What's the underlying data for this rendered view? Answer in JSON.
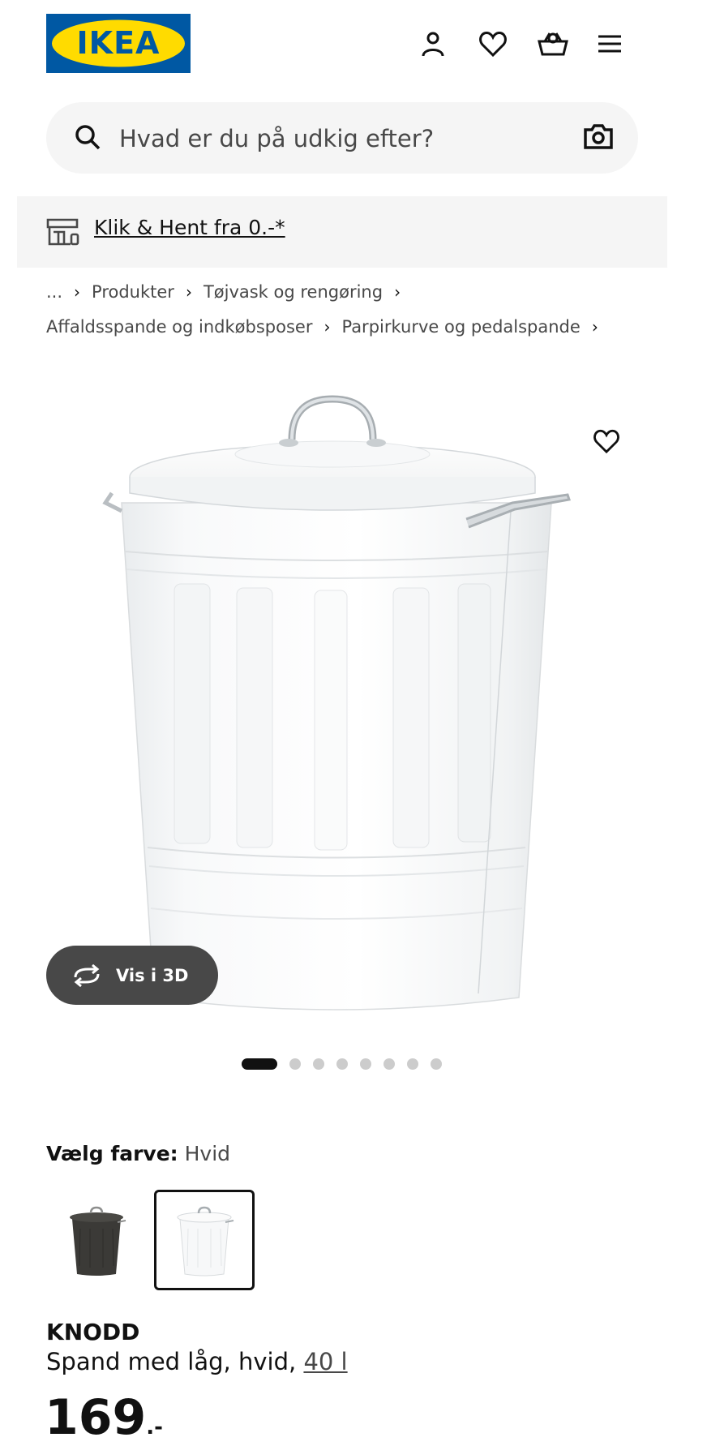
{
  "header": {
    "logo_text": "IKEA",
    "icons": [
      "profile-icon",
      "heart-icon",
      "basket-icon",
      "menu-icon"
    ]
  },
  "search": {
    "placeholder": "Hvad er du på udkig efter?"
  },
  "banner": {
    "link_text": "Klik & Hent fra 0.-*"
  },
  "breadcrumb": {
    "items": [
      "...",
      "Produkter",
      "Tøjvask og rengøring",
      "Affaldsspande og indkøbsposer",
      "Parpirkurve og pedalspande"
    ]
  },
  "gallery": {
    "view_3d_label": "Vis i 3D",
    "image_count": 8,
    "active_index": 1
  },
  "color": {
    "label": "Vælg farve:",
    "selected": "Hvid",
    "options": [
      "dark-grey",
      "white"
    ]
  },
  "product": {
    "name": "KNODD",
    "description": "Spand med låg, hvid,",
    "size_link": "40 l",
    "price": "169",
    "price_suffix": ".-"
  },
  "colors": {
    "brand_blue": "#0058a3",
    "brand_yellow": "#ffdb00",
    "text": "#111111",
    "secondary_text": "#484848",
    "surface": "#f5f5f5"
  }
}
